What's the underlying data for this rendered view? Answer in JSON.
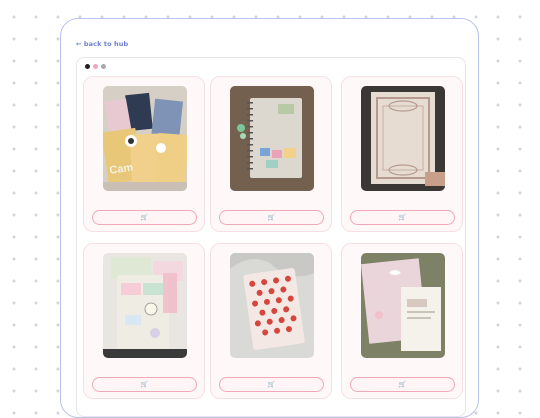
{
  "nav": {
    "back_label": "← back to hub"
  },
  "window": {
    "dot_colors": [
      "#1f1f1f",
      "#f0a8b8",
      "#aaaaaa"
    ]
  },
  "grid": {
    "items": [
      {
        "name": "product-kamio-campus-notebooks",
        "icon": "shopping-cart-icon",
        "cart_glyph": "🛒"
      },
      {
        "name": "product-spiral-sticker-notebook",
        "icon": "shopping-cart-icon",
        "cart_glyph": "🛒"
      },
      {
        "name": "product-ornate-frame-journal",
        "icon": "shopping-cart-icon",
        "cart_glyph": "🛒"
      },
      {
        "name": "product-planner-with-stickers",
        "icon": "shopping-cart-icon",
        "cart_glyph": "🛒"
      },
      {
        "name": "product-strawberry-notebook",
        "icon": "shopping-cart-icon",
        "cart_glyph": "🛒"
      },
      {
        "name": "product-pastel-notebook-set",
        "icon": "shopping-cart-icon",
        "cart_glyph": "🛒"
      }
    ]
  }
}
